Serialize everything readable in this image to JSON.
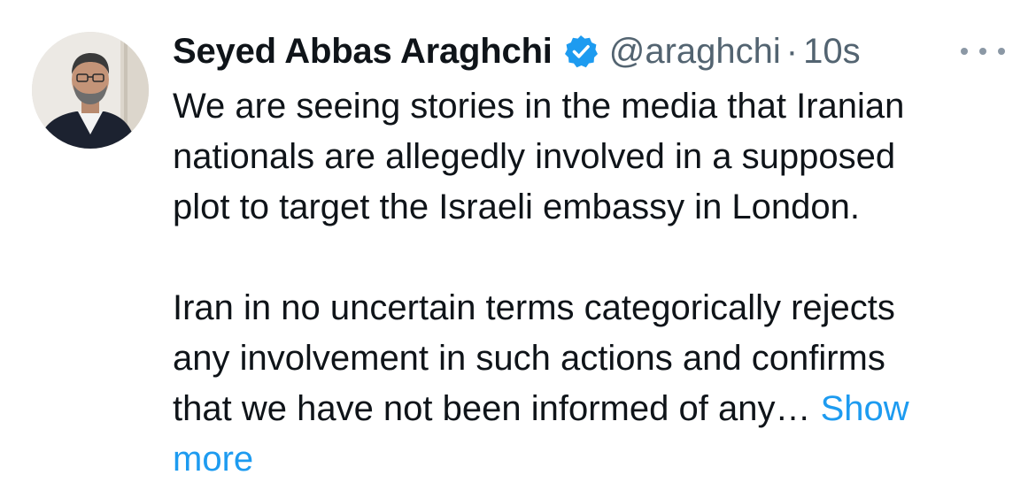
{
  "tweet": {
    "author": {
      "display_name": "Seyed Abbas Araghchi",
      "verified": true,
      "handle": "@araghchi",
      "separator": "·",
      "time": "10s",
      "avatar_icon": "profile-photo"
    },
    "more_icon": "more-horizontal-icon",
    "text": {
      "paragraph_1": [
        "We are seeing stories in the media that Iranian",
        "nationals are allegedly involved in a supposed",
        "plot to target the Israeli embassy in London."
      ],
      "paragraph_2": [
        "Iran in no uncertain terms categorically rejects",
        "any involvement in such actions and confirms",
        "that we have not been informed of any…"
      ]
    },
    "show_more_label_1": "Show",
    "show_more_label_2": "more",
    "colors": {
      "text": "#0f1419",
      "secondary": "#536471",
      "link": "#1d9bf0",
      "verified_badge": "#1d9bf0"
    }
  }
}
